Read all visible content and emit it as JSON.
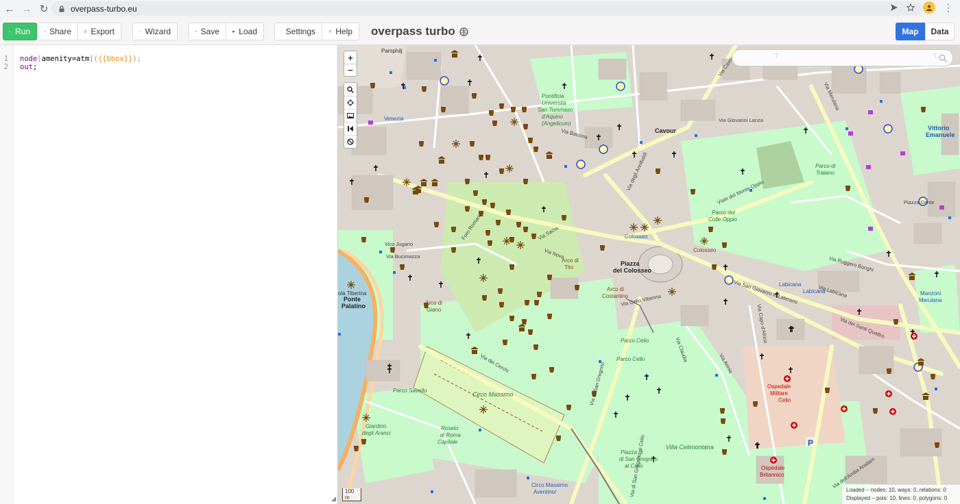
{
  "browser": {
    "url": "overpass-turbo.eu"
  },
  "toolbar": {
    "run": "Run",
    "share": "Share",
    "export": "Export",
    "wizard": "Wizard",
    "save": "Save",
    "load": "Load",
    "settings": "Settings",
    "help": "Help"
  },
  "app": {
    "title": "overpass turbo"
  },
  "views": {
    "map": "Map",
    "data": "Data"
  },
  "editor": {
    "line1_no": "1",
    "line2_no": "2",
    "line1_node": "node",
    "line1_open": "[",
    "line1_filter": "amenity=atm",
    "line1_close": "](",
    "line1_tmpl": "{{bbox}}",
    "line1_end": ");",
    "line2_out": "out",
    "line2_end": ";"
  },
  "map": {
    "labels": {
      "pamphilj": "Pamphilj",
      "venezia": "Venezia",
      "pontificia": "Pontificia",
      "universita": "Università",
      "tommaso": "San Tommaso",
      "aquino": "d'Aquino",
      "angelicum": "(Angelicum)",
      "via_cavour": "Via Cavour",
      "cavour": "Cavour",
      "via_giovanni_lanza": "Via Giovanni Lanza",
      "via_baccina": "Via Baccina",
      "via_degli_annibaldi": "Via degli Annibaldi",
      "via_merulana": "Via Merulana",
      "vittorio": "Vittorio",
      "emanuele": "Emanuele",
      "parco_di": "Parco di",
      "traiano": "Traiano",
      "parco_del": "Parco del",
      "colle_oppio": "Colle Oppio",
      "viale_monte_oppio": "Viale del Monte Oppio",
      "colosseo": "Colosseo",
      "colosseo2": "Colosseo",
      "via_labicana": "Via Labicana",
      "piazza": "Piazza",
      "del_colosseo": "del Colosseo",
      "via_sacra": "Via Sacra",
      "via_nova": "Via Nova",
      "foro_romano": "Foro Romano",
      "arco_di": "Arco di",
      "tito": "Tito",
      "arco_di_cost": "Arco di",
      "costantino": "Costantino",
      "via_celio_vibenna": "Via Celio Vibenna",
      "vico_jugario": "Vico Jugario",
      "via_bucimazza": "Via Bucimazza",
      "arco_di_giano": "Arco di",
      "giano": "Giano",
      "ponte": "Ponte",
      "palatino": "Palatino",
      "isola_tiberina": "ola Tiberina",
      "via_dei_cerchi": "Via dei Cerchi",
      "circo_massimo": "Circo Massimo",
      "parco_savello": "Parco Savello",
      "giardino": "Giardino",
      "degli_aranci": "degli Aranci",
      "roseto": "Roseto",
      "di_roma": "di Roma",
      "capitale": "Capitale",
      "via_san_gregorio": "Via di San Gregorio",
      "parco_celio": "Parco Celio",
      "parco_celio2": "Parco Celio",
      "villa_celimontana": "Villa Celimontana",
      "ospedale": "Ospedale",
      "militare": "Militare",
      "celio": "Celio",
      "ospedale_b": "Ospedale",
      "britannico": "Britannico",
      "labicana": "Labicana",
      "labicana2": "Labicana",
      "manzoni": "Manzoni",
      "merulana": "Merulana",
      "circo_massimo_metro": "Circo Massimo",
      "aventino": "Aventino/",
      "via_claudia": "Via Claudia",
      "via_san_giovanni": "Via San Giovanni in Laterano",
      "via_dei_santi_quattro": "Via dei Santi Quattro",
      "via_marmorata": "Via Annia",
      "via_capo_dafrica": "Via Capo d'Africa",
      "via_amba_aradam": "Via dell'Amba Aradam",
      "via_ruggero_bonghi": "Via Ruggero Bonghi",
      "piazza_dante": "Piazza Dante",
      "via_san_sebastiano": "Via di San Gregorio al Celio",
      "san_gregorio": "di San Gregorio",
      "al_celio": "al Celio",
      "piazza_di": "Piazza di"
    },
    "scale": "100 m",
    "stats_loaded": "Loaded – nodes: 10, ways: 0, relations: 0",
    "stats_displayed": "Displayed – pois: 10, lines: 0, polygons: 0"
  },
  "colors": {
    "run": "#3ec46d",
    "map_active": "#3273dc",
    "park": "#c8facc",
    "road_major": "#f9f8b8",
    "water": "#aad3df"
  }
}
